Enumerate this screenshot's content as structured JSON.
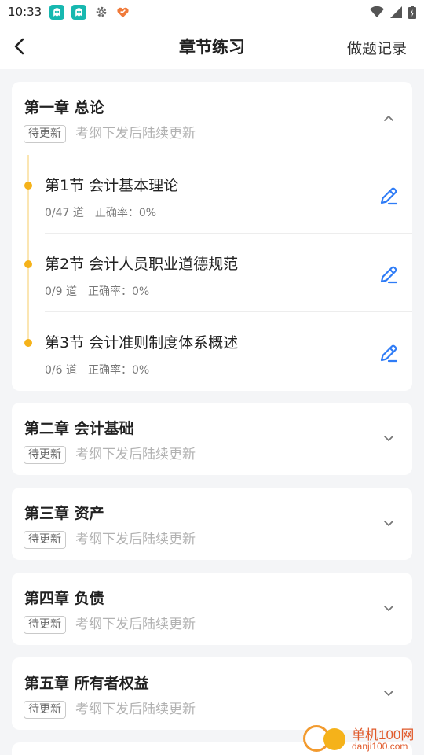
{
  "status_bar": {
    "time": "10:33",
    "icons": [
      "app-ghost-icon",
      "app-ghost-icon",
      "gear-icon",
      "heart-app-icon",
      "wifi-icon",
      "signal-icon",
      "battery-icon"
    ]
  },
  "navbar": {
    "title": "章节练习",
    "right_action": "做题记录"
  },
  "chapters": [
    {
      "title": "第一章 总论",
      "tag": "待更新",
      "note": "考纲下发后陆续更新",
      "expanded": true,
      "sections": [
        {
          "title": "第1节  会计基本理论",
          "count": "0/47 道",
          "accuracy": "正确率：0%"
        },
        {
          "title": "第2节  会计人员职业道德规范",
          "count": "0/9 道",
          "accuracy": "正确率：0%"
        },
        {
          "title": "第3节  会计准则制度体系概述",
          "count": "0/6 道",
          "accuracy": "正确率：0%"
        }
      ]
    },
    {
      "title": "第二章 会计基础",
      "tag": "待更新",
      "note": "考纲下发后陆续更新",
      "expanded": false
    },
    {
      "title": "第三章 资产",
      "tag": "待更新",
      "note": "考纲下发后陆续更新",
      "expanded": false
    },
    {
      "title": "第四章 负债",
      "tag": "待更新",
      "note": "考纲下发后陆续更新",
      "expanded": false
    },
    {
      "title": "第五章 所有者权益",
      "tag": "待更新",
      "note": "考纲下发后陆续更新",
      "expanded": false
    }
  ],
  "watermark": {
    "name": "单机100网",
    "url": "danji100.com"
  },
  "colors": {
    "accent_dot": "#f5b21a",
    "edit_icon": "#2f7cf6",
    "background": "#f4f5f7"
  }
}
